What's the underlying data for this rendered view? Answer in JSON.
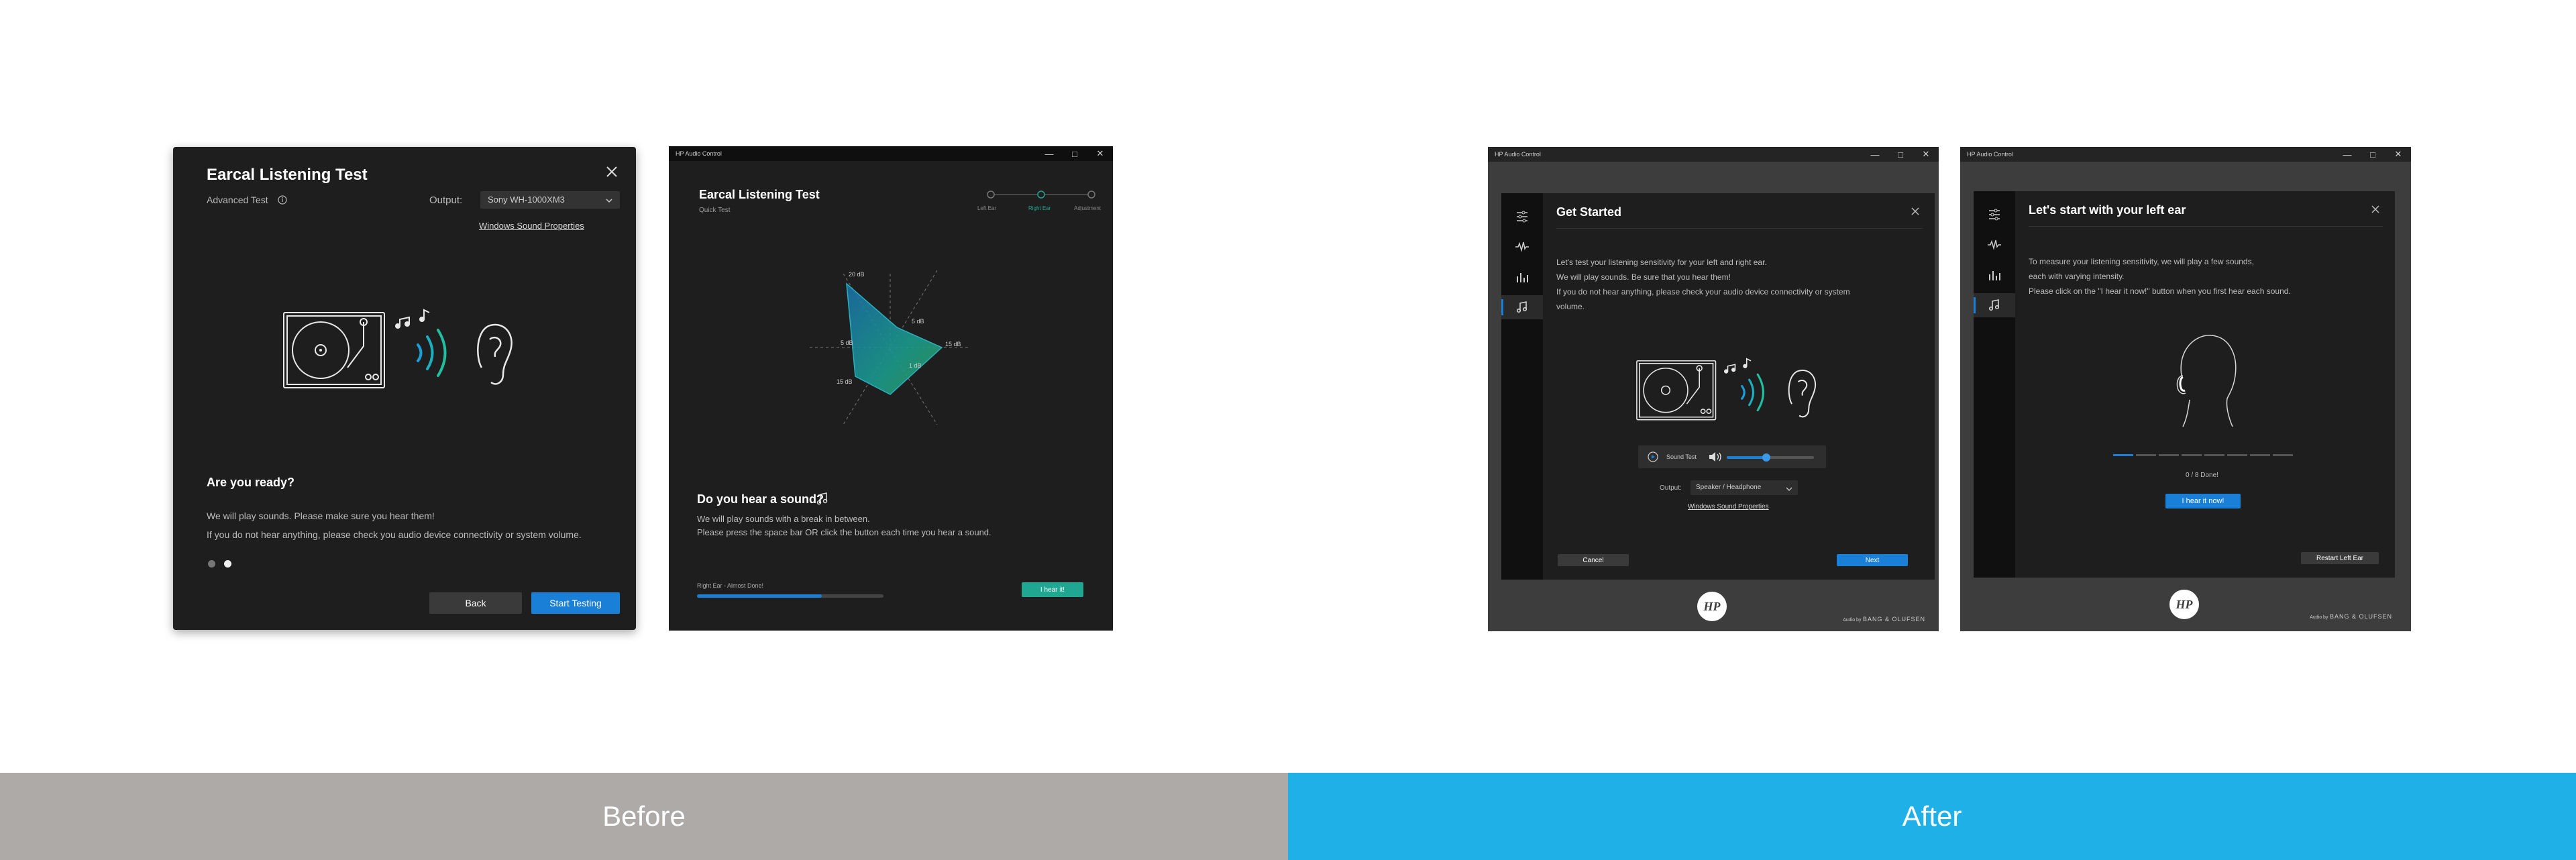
{
  "labels": {
    "before": "Before",
    "after": "After"
  },
  "colors": {
    "before_bar": "#adaaa8",
    "after_bar": "#1fb0e8",
    "accent_blue": "#1a7fd6",
    "accent_teal": "#1fa792"
  },
  "before1": {
    "title": "Earcal Listening Test",
    "advanced": "Advanced Test",
    "output_label": "Output:",
    "output_value": "Sony WH-1000XM3",
    "sound_props": "Windows Sound Properties",
    "question": "Are you ready?",
    "line1": "We will play sounds. Please make sure you hear them!",
    "line2": "If you do not hear anything, please check you audio device connectivity or system volume.",
    "back": "Back",
    "start": "Start Testing"
  },
  "before2": {
    "app": "HP Audio Control",
    "title": "Earcal Listening Test",
    "subtitle": "Quick Test",
    "steps": [
      "Left Ear",
      "Right Ear",
      "Adjustment"
    ],
    "radar_labels": [
      "20 dB",
      "5 dB",
      "15 dB",
      "5 dB",
      "15 dB",
      "1 dB"
    ],
    "question": "Do you hear a sound?",
    "line1": "We will play sounds with a break in between.",
    "line2": "Please press the space bar OR click the button each time you hear a sound.",
    "progress_label": "Right Ear - Almost Done!",
    "progress": 0.67,
    "button": "I hear it!"
  },
  "after1": {
    "app": "HP Audio Control",
    "title": "Get Started",
    "line1": "Let's test your listening sensitivity for your left and right ear.",
    "line2": "We will play sounds. Be sure that you hear them!",
    "line3": "If you do not hear anything, please check your audio device connectivity or system",
    "line4": "volume.",
    "sound_test": "Sound Test",
    "volume": 0.45,
    "output_label": "Output:",
    "output_value": "Speaker / Headphone",
    "sound_props": "Windows Sound Properties",
    "cancel": "Cancel",
    "next": "Next",
    "brand": "HP",
    "audio_by": "Audio by",
    "bo": "BANG & OLUFSEN"
  },
  "after2": {
    "app": "HP Audio Control",
    "title": "Let's start with your left ear",
    "line1": "To measure your listening sensitivity, we will play a few sounds,",
    "line2": "each with varying intensity.",
    "line3": "Please click on the \"I hear it now!\" button when you first hear each sound.",
    "progress_text": "0 / 8 Done!",
    "button": "I hear it now!",
    "restart": "Restart Left Ear",
    "brand": "HP",
    "audio_by": "Audio by",
    "bo": "BANG & OLUFSEN"
  }
}
